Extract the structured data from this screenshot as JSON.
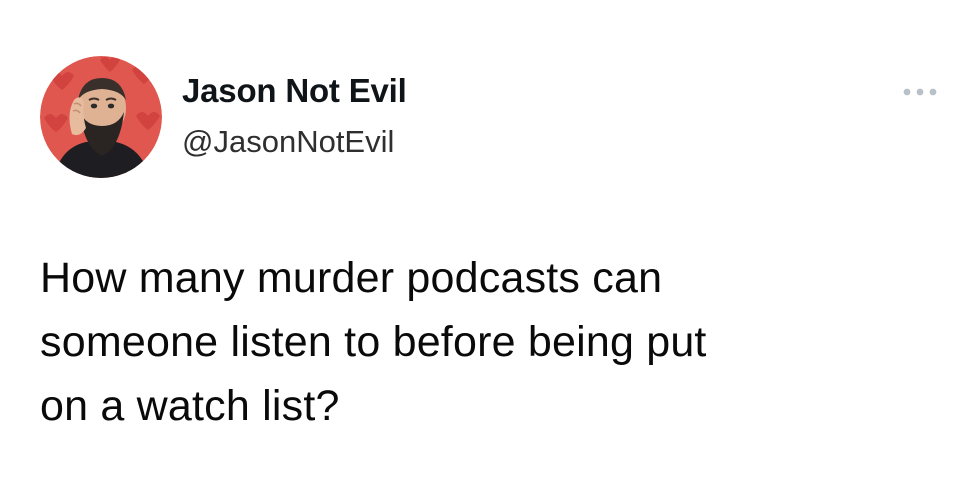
{
  "tweet": {
    "author": {
      "display_name": "Jason Not Evil",
      "handle": "@JasonNotEvil",
      "avatar_icon": "profile-photo"
    },
    "menu_icon": "more-options-icon",
    "text_lines": [
      "How many murder podcasts can",
      "someone listen to before being put",
      "on a watch list?"
    ]
  },
  "colors": {
    "avatar_background": "#e0574f",
    "text": "#0f1419",
    "menu_dots": "#b8c0c8"
  }
}
